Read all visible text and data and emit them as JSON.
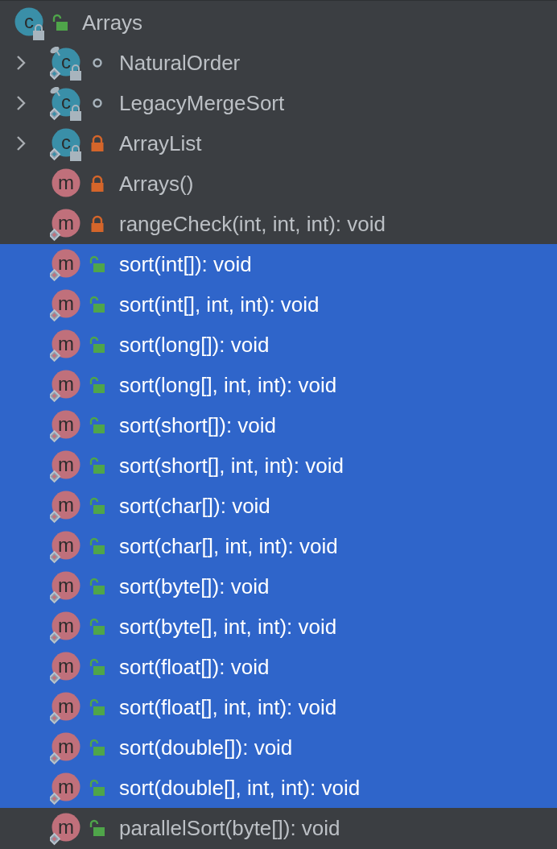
{
  "tree": {
    "name": "Arrays",
    "kind": "class",
    "badge": "c",
    "access": {
      "kind": "public"
    },
    "final": true,
    "static": false,
    "inner": false,
    "selected": false,
    "children": [
      {
        "name": "NaturalOrder",
        "kind": "class",
        "badge": "c",
        "access": {
          "kind": "package"
        },
        "final": true,
        "static": true,
        "inner": true,
        "expanded": false,
        "selected": false
      },
      {
        "name": "LegacyMergeSort",
        "kind": "class",
        "badge": "c",
        "access": {
          "kind": "package"
        },
        "final": true,
        "static": true,
        "inner": true,
        "expanded": false,
        "selected": false
      },
      {
        "name": "ArrayList",
        "kind": "class",
        "badge": "c",
        "access": {
          "kind": "private"
        },
        "final": true,
        "static": true,
        "inner": false,
        "expanded": false,
        "selected": false
      },
      {
        "name": "Arrays()",
        "kind": "method",
        "badge": "m",
        "access": {
          "kind": "private"
        },
        "final": false,
        "static": false,
        "inner": false,
        "selected": false
      },
      {
        "name": "rangeCheck(int, int, int): void",
        "kind": "method",
        "badge": "m",
        "access": {
          "kind": "private"
        },
        "final": false,
        "static": true,
        "inner": false,
        "selected": false
      },
      {
        "name": "sort(int[]): void",
        "kind": "method",
        "badge": "m",
        "access": {
          "kind": "public"
        },
        "final": false,
        "static": true,
        "inner": false,
        "selected": true
      },
      {
        "name": "sort(int[], int, int): void",
        "kind": "method",
        "badge": "m",
        "access": {
          "kind": "public"
        },
        "final": false,
        "static": true,
        "inner": false,
        "selected": true
      },
      {
        "name": "sort(long[]): void",
        "kind": "method",
        "badge": "m",
        "access": {
          "kind": "public"
        },
        "final": false,
        "static": true,
        "inner": false,
        "selected": true
      },
      {
        "name": "sort(long[], int, int): void",
        "kind": "method",
        "badge": "m",
        "access": {
          "kind": "public"
        },
        "final": false,
        "static": true,
        "inner": false,
        "selected": true
      },
      {
        "name": "sort(short[]): void",
        "kind": "method",
        "badge": "m",
        "access": {
          "kind": "public"
        },
        "final": false,
        "static": true,
        "inner": false,
        "selected": true
      },
      {
        "name": "sort(short[], int, int): void",
        "kind": "method",
        "badge": "m",
        "access": {
          "kind": "public"
        },
        "final": false,
        "static": true,
        "inner": false,
        "selected": true
      },
      {
        "name": "sort(char[]): void",
        "kind": "method",
        "badge": "m",
        "access": {
          "kind": "public"
        },
        "final": false,
        "static": true,
        "inner": false,
        "selected": true
      },
      {
        "name": "sort(char[], int, int): void",
        "kind": "method",
        "badge": "m",
        "access": {
          "kind": "public"
        },
        "final": false,
        "static": true,
        "inner": false,
        "selected": true
      },
      {
        "name": "sort(byte[]): void",
        "kind": "method",
        "badge": "m",
        "access": {
          "kind": "public"
        },
        "final": false,
        "static": true,
        "inner": false,
        "selected": true
      },
      {
        "name": "sort(byte[], int, int): void",
        "kind": "method",
        "badge": "m",
        "access": {
          "kind": "public"
        },
        "final": false,
        "static": true,
        "inner": false,
        "selected": true
      },
      {
        "name": "sort(float[]): void",
        "kind": "method",
        "badge": "m",
        "access": {
          "kind": "public"
        },
        "final": false,
        "static": true,
        "inner": false,
        "selected": true
      },
      {
        "name": "sort(float[], int, int): void",
        "kind": "method",
        "badge": "m",
        "access": {
          "kind": "public"
        },
        "final": false,
        "static": true,
        "inner": false,
        "selected": true
      },
      {
        "name": "sort(double[]): void",
        "kind": "method",
        "badge": "m",
        "access": {
          "kind": "public"
        },
        "final": false,
        "static": true,
        "inner": false,
        "selected": true
      },
      {
        "name": "sort(double[], int, int): void",
        "kind": "method",
        "badge": "m",
        "access": {
          "kind": "public"
        },
        "final": false,
        "static": true,
        "inner": false,
        "selected": true
      },
      {
        "name": "parallelSort(byte[]): void",
        "kind": "method",
        "badge": "m",
        "access": {
          "kind": "public"
        },
        "final": false,
        "static": true,
        "inner": false,
        "selected": false
      }
    ]
  }
}
